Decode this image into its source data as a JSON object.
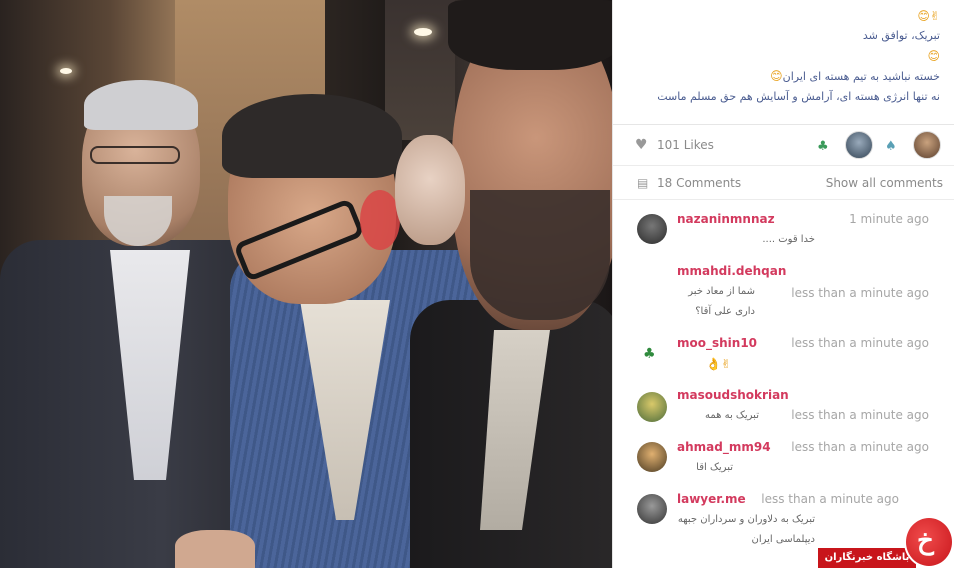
{
  "caption": {
    "line1_emoji": "✌😊",
    "line2": "تبریک، توافق شد",
    "line3_emoji": "😊",
    "line4": "خسته نباشید به تیم هسته ای ایران",
    "line4_emoji": "😊",
    "line5": "نه تنها انرژی هسته ای، آرامش و آسایش هم حق مسلم ماست"
  },
  "likes": {
    "icon": "heart-icon",
    "text": "101 Likes"
  },
  "comments_bar": {
    "icon": "comment-icon",
    "count": "18 Comments",
    "show_all": "Show all comments"
  },
  "comments": [
    {
      "user": "nazaninmnnaz",
      "time": "1 minute ago",
      "text": "خدا قوت ....",
      "avatar_color": "#3a3a3a"
    },
    {
      "user": "mmahdi.dehqan",
      "time": "less than a minute ago",
      "text": "شما از معاد خبر داری علی آقا؟",
      "avatar_color": ""
    },
    {
      "user": "moo_shin10",
      "time": "less than a minute ago",
      "text": "✌👌",
      "avatar_color": "#2f8a3d"
    },
    {
      "user": "masoudshokrian",
      "time": "less than a minute ago",
      "text": "تبریک به همه",
      "avatar_color": "#4b6b3a"
    },
    {
      "user": "ahmad_mm94",
      "time": "less than a minute ago",
      "text": "تبریک اقا",
      "avatar_color": "#6a5a3a"
    },
    {
      "user": "lawyer.me",
      "time": "less than a minute ago",
      "text": "تبریک به دلاوران و سرداران جبهه دیپلماسی ایران",
      "avatar_color": "#555555"
    }
  ],
  "watermark": {
    "logo_letter": "خ",
    "label": "باشگاه خبرنگاران"
  },
  "colors": {
    "username": "#d33a5e",
    "caption": "#4a5c90",
    "meta": "#a6a6a6",
    "watermark": "#c8151b"
  }
}
